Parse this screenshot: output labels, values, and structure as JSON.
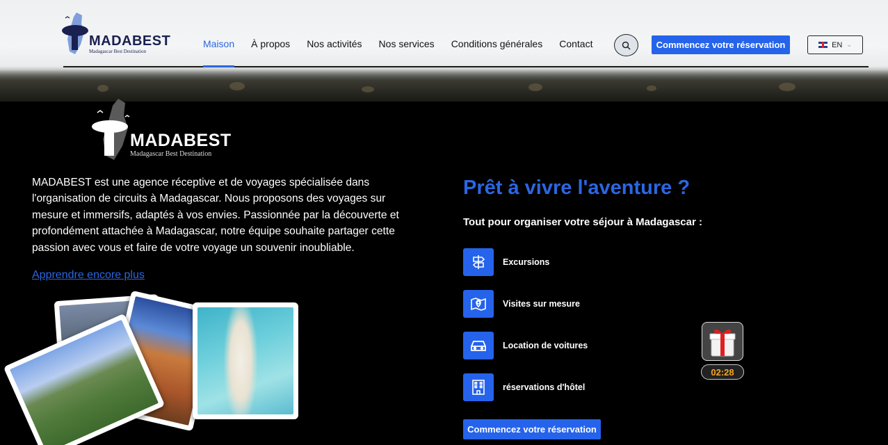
{
  "header": {
    "logo": {
      "brand": "MADABEST",
      "tagline": "Madagascar Best Destination"
    },
    "nav": [
      {
        "label": "Maison",
        "active": true
      },
      {
        "label": "À propos"
      },
      {
        "label": "Nos activités"
      },
      {
        "label": "Nos services"
      },
      {
        "label": "Conditions générales"
      },
      {
        "label": "Contact"
      }
    ],
    "search_icon": "search-icon",
    "cta_label": "Commencez votre réservation",
    "language": {
      "code": "EN",
      "flag_icon": "uk-flag-icon"
    }
  },
  "about": {
    "logo": {
      "brand": "MADABEST",
      "tagline": "Madagascar Best Destination"
    },
    "text": "MADABEST est une agence réceptive et de voyages spécialisée dans l'organisation de circuits à Madagascar. Nous proposons des voyages sur mesure et immersifs, adaptés à vos envies. Passionnée par la découverte et profondément attachée à Madagascar, notre équipe souhaite partager cette passion avec vous et faire de votre voyage un souvenir inoubliable.",
    "link_label": "Apprendre encore plus"
  },
  "hero": {
    "title": "Prêt à vivre l'aventure ?",
    "subtitle": "Tout pour organiser votre séjour à Madagascar :",
    "services": [
      {
        "label": "Excursions",
        "icon": "signpost-icon"
      },
      {
        "label": "Visites sur mesure",
        "icon": "map-pin-icon"
      },
      {
        "label": "Location de voitures",
        "icon": "car-icon"
      },
      {
        "label": "réservations d'hôtel",
        "icon": "hotel-icon"
      }
    ],
    "cta_label": "Commencez votre réservation"
  },
  "promo": {
    "icon": "gift-icon",
    "countdown": "02:28"
  },
  "colors": {
    "accent": "#2563eb",
    "brand_dark": "#1a2050",
    "countdown": "#f5a623"
  }
}
